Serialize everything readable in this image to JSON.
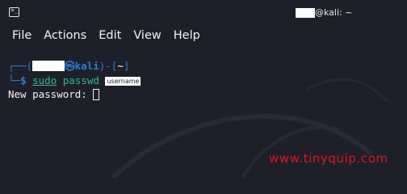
{
  "window": {
    "title_suffix": "@kali: ~"
  },
  "menu": {
    "items": [
      "File",
      "Actions",
      "Edit",
      "View",
      "Help"
    ]
  },
  "terminal": {
    "prompt_corner_top": "┌──(",
    "prompt_at": "㉿",
    "prompt_host": "kali",
    "prompt_mid": ")-[",
    "prompt_dir": "~",
    "prompt_close": "]",
    "prompt_corner_bottom": "└─",
    "prompt_dollar": "$ ",
    "cmd_sudo": "sudo",
    "cmd_passwd": " passwd ",
    "arg_placeholder": "username",
    "output_line": "New password: "
  },
  "watermark": {
    "text": "www.tinyquip.com",
    "color": "#e0141e"
  },
  "colors": {
    "background": "#1d2029",
    "prompt_blue": "#2f7bd8",
    "command_teal": "#3bb39b"
  }
}
